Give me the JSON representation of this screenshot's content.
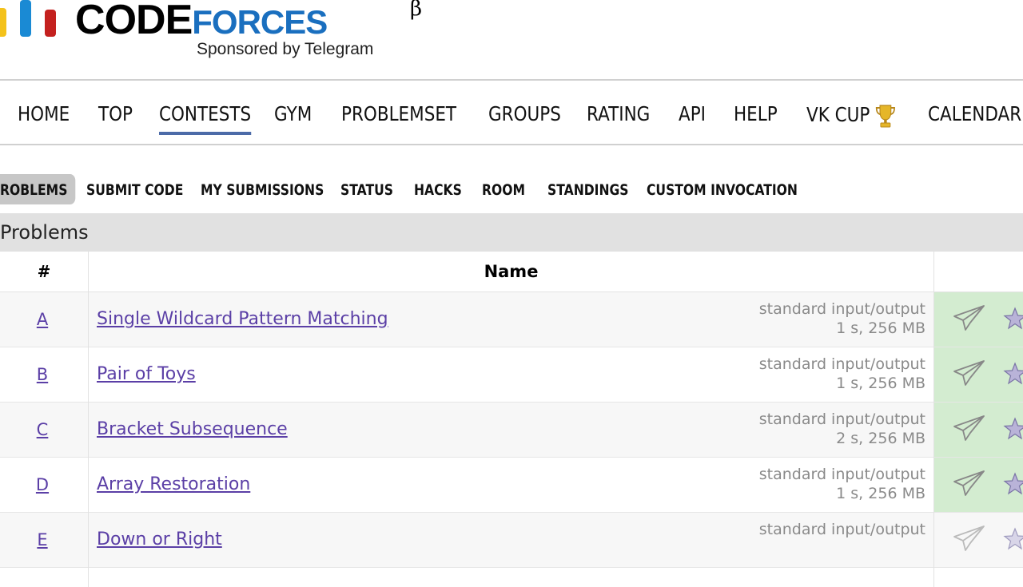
{
  "logo": {
    "text_code_first": "C",
    "text_code_rest": "ODE",
    "text_forces": "FORCES",
    "beta": "β",
    "sponsor": "Sponsored by Telegram"
  },
  "main_menu": [
    "HOME",
    "TOP",
    "CONTESTS",
    "GYM",
    "PROBLEMSET",
    "GROUPS",
    "RATING",
    "API",
    "HELP",
    "VK CUP",
    "CALENDAR"
  ],
  "main_menu_active": "CONTESTS",
  "sub_menu": [
    "ROBLEMS",
    "SUBMIT CODE",
    "MY SUBMISSIONS",
    "STATUS",
    "HACKS",
    "ROOM",
    "STANDINGS",
    "CUSTOM INVOCATION"
  ],
  "sub_menu_selected": "ROBLEMS",
  "panel": {
    "title": "Problems"
  },
  "table": {
    "headers": {
      "num": "#",
      "name": "Name"
    },
    "rows": [
      {
        "id": "A",
        "name": "Single Wildcard Pattern Matching",
        "io": "standard input/output",
        "limits": "1 s, 256 MB"
      },
      {
        "id": "B",
        "name": "Pair of Toys",
        "io": "standard input/output",
        "limits": "1 s, 256 MB"
      },
      {
        "id": "C",
        "name": "Bracket Subsequence",
        "io": "standard input/output",
        "limits": "2 s, 256 MB"
      },
      {
        "id": "D",
        "name": "Array Restoration",
        "io": "standard input/output",
        "limits": "1 s, 256 MB"
      },
      {
        "id": "E",
        "name": "Down or Right",
        "io": "standard input/output",
        "limits": ""
      }
    ]
  },
  "icons": {
    "trophy": "trophy-icon",
    "submit": "paper-plane-icon",
    "favorite": "star-icon"
  },
  "colors": {
    "link": "#5b3fa6",
    "accepted_bg": "#d3ecd0",
    "forces_blue": "#1a6fbf",
    "active_underline": "#4c6ba8"
  }
}
